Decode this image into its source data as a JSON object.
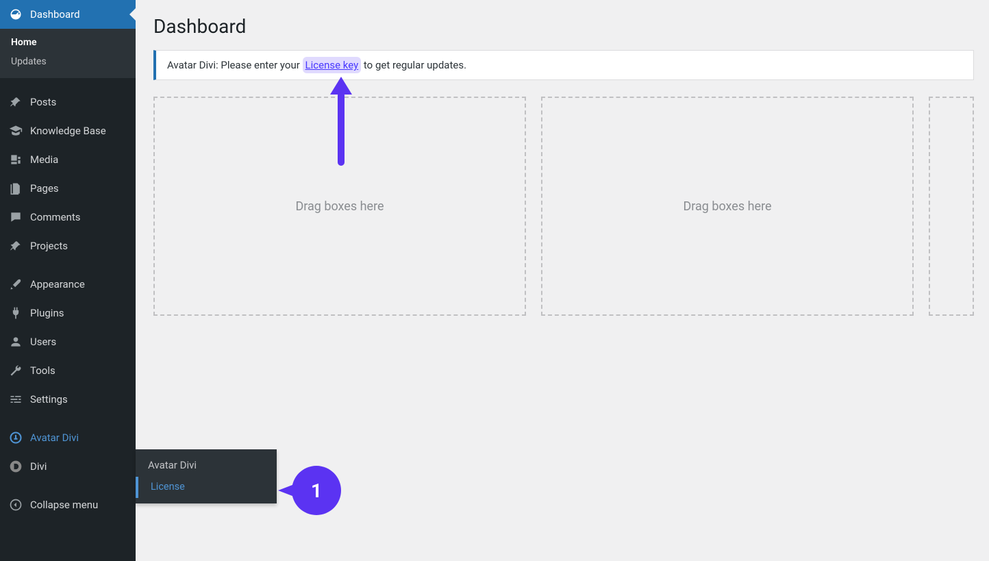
{
  "sidebar": {
    "dashboard": {
      "label": "Dashboard",
      "sub_home": "Home",
      "sub_updates": "Updates"
    },
    "posts": "Posts",
    "kb": "Knowledge Base",
    "media": "Media",
    "pages": "Pages",
    "comments": "Comments",
    "projects": "Projects",
    "appearance": "Appearance",
    "plugins": "Plugins",
    "users": "Users",
    "tools": "Tools",
    "settings": "Settings",
    "avatar_divi": "Avatar Divi",
    "divi": "Divi",
    "collapse": "Collapse menu"
  },
  "flyout": {
    "title": "Avatar Divi",
    "license": "License"
  },
  "page": {
    "title": "Dashboard",
    "notice_pre": "Avatar Divi: Please enter your ",
    "notice_link": "License key",
    "notice_post": " to get regular updates.",
    "dropzone": "Drag boxes here"
  },
  "annotations": {
    "badge1": "1"
  },
  "colors": {
    "wp_blue": "#2271b1",
    "annotation_purple": "#5b33f2"
  }
}
